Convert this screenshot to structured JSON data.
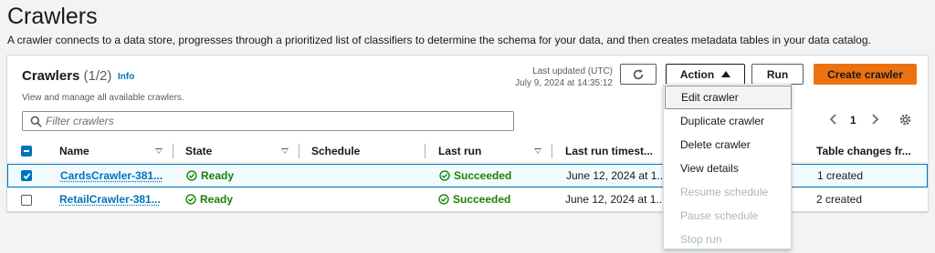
{
  "page": {
    "title": "Crawlers",
    "description": "A crawler connects to a data store, progresses through a prioritized list of classifiers to determine the schema for your data, and then creates metadata tables in your data catalog."
  },
  "panel": {
    "title": "Crawlers",
    "count": "(1/2)",
    "info": "Info",
    "subtitle": "View and manage all available crawlers.",
    "last_updated_label": "Last updated (UTC)",
    "last_updated_value": "July 9, 2024 at 14:35:12",
    "buttons": {
      "action": "Action",
      "run": "Run",
      "create": "Create crawler"
    },
    "search_placeholder": "Filter crawlers",
    "page_number": "1"
  },
  "table": {
    "columns": [
      "Name",
      "State",
      "Schedule",
      "Last run",
      "Last run timest...",
      "Table changes fr..."
    ],
    "rows": [
      {
        "name": "CardsCrawler-381...",
        "state": "Ready",
        "schedule": "",
        "last_run": "Succeeded",
        "last_run_timestamp": "June 12, 2024 at 1...",
        "table_changes": "1 created",
        "selected": true
      },
      {
        "name": "RetailCrawler-381...",
        "state": "Ready",
        "schedule": "",
        "last_run": "Succeeded",
        "last_run_timestamp": "June 12, 2024 at 1...",
        "table_changes": "2 created",
        "selected": false
      }
    ]
  },
  "action_menu": {
    "items": [
      {
        "label": "Edit crawler",
        "enabled": true
      },
      {
        "label": "Duplicate crawler",
        "enabled": true
      },
      {
        "label": "Delete crawler",
        "enabled": true
      },
      {
        "label": "View details",
        "enabled": true
      },
      {
        "label": "Resume schedule",
        "enabled": false
      },
      {
        "label": "Pause schedule",
        "enabled": false
      },
      {
        "label": "Stop run",
        "enabled": false
      }
    ]
  },
  "colors": {
    "primary": "#ec7211",
    "link": "#0073bb",
    "success": "#1d8102",
    "disabled": "#aab7b8"
  },
  "icons": [
    "refresh-icon",
    "caret-up-icon",
    "search-icon",
    "chevron-left-icon",
    "chevron-right-icon",
    "settings-icon",
    "check-circle-icon",
    "sort-down-icon"
  ]
}
